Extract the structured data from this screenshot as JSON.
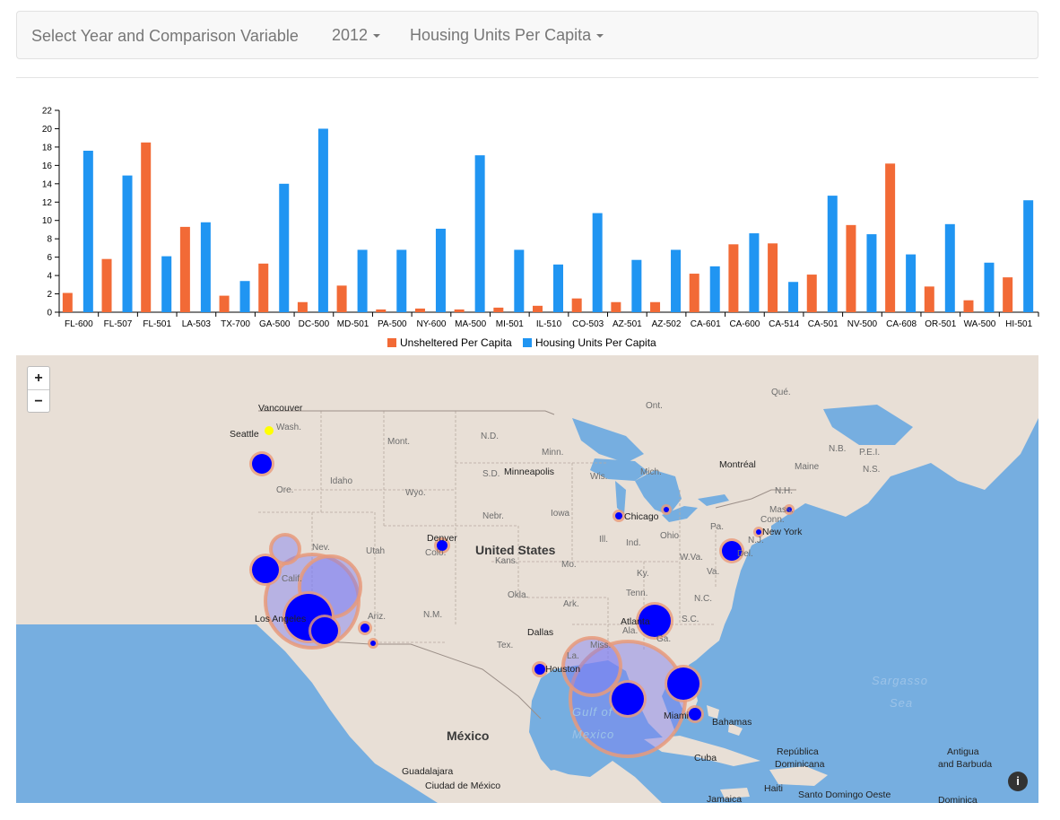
{
  "navbar": {
    "title": "Select Year and Comparison Variable",
    "year": "2012",
    "variable": "Housing Units Per Capita"
  },
  "colors": {
    "unsheltered": "#f26a36",
    "housing": "#2095f2",
    "bubble_fill": "#0000ff",
    "bubble_halo": "#e89a7a",
    "water": "#76aee0",
    "land": "#e8dfd6"
  },
  "chart_data": {
    "type": "bar",
    "categories": [
      "FL-600",
      "FL-507",
      "FL-501",
      "LA-503",
      "TX-700",
      "GA-500",
      "DC-500",
      "MD-501",
      "PA-500",
      "NY-600",
      "MA-500",
      "MI-501",
      "IL-510",
      "CO-503",
      "AZ-501",
      "AZ-502",
      "CA-601",
      "CA-600",
      "CA-514",
      "CA-501",
      "NV-500",
      "CA-608",
      "OR-501",
      "WA-500",
      "HI-501"
    ],
    "series": [
      {
        "name": "Unsheltered Per Capita",
        "values": [
          2.1,
          5.8,
          18.5,
          9.3,
          1.8,
          5.3,
          1.1,
          2.9,
          0.3,
          0.4,
          0.3,
          0.5,
          0.7,
          1.5,
          1.1,
          1.1,
          4.2,
          7.4,
          7.5,
          4.1,
          9.5,
          16.2,
          2.8,
          1.3,
          3.8
        ]
      },
      {
        "name": "Housing Units Per Capita",
        "values": [
          17.6,
          14.9,
          6.1,
          9.8,
          3.4,
          14.0,
          20.0,
          6.8,
          6.8,
          9.1,
          17.1,
          6.8,
          5.2,
          10.8,
          5.7,
          6.8,
          5.0,
          8.6,
          3.3,
          12.7,
          8.5,
          6.3,
          9.6,
          5.4,
          12.2
        ]
      }
    ],
    "yticks": [
      "0",
      "2",
      "4",
      "6",
      "8",
      "10",
      "12",
      "14",
      "16",
      "18",
      "20",
      "22"
    ],
    "ylim": [
      0,
      22
    ],
    "legend": "bottom-center"
  },
  "map": {
    "zoom_in": "+",
    "zoom_out": "−",
    "info": "i",
    "labels": {
      "vancouver": "Vancouver",
      "seattle": "Seattle",
      "wash": "Wash.",
      "mont": "Mont.",
      "nd": "N.D.",
      "minn": "Minn.",
      "ont": "Ont.",
      "que": "Qué.",
      "nb": "N.B.",
      "pei": "P.E.I.",
      "ns": "N.S.",
      "montreal": "Montréal",
      "maine": "Maine",
      "nh": "N.H.",
      "mass": "Mass.",
      "conn": "Conn.",
      "new_york": "New York",
      "nj": "N.J.",
      "del": "Del.",
      "pa": "Pa.",
      "ohio": "Ohio",
      "wva": "W.Va.",
      "va": "Va.",
      "ky": "Ky.",
      "tenn": "Tenn.",
      "nc": "N.C.",
      "sc": "S.C.",
      "ga": "Ga.",
      "ala": "Ala.",
      "atlanta": "Atlanta",
      "miss": "Miss.",
      "la": "La.",
      "ark": "Ark.",
      "mo": "Mo.",
      "ill": "Ill.",
      "ind": "Ind.",
      "mich": "Mich.",
      "wis": "Wis.",
      "iowa": "Iowa",
      "chicago": "Chicago",
      "minneapolis": "Minneapolis",
      "sd": "S.D.",
      "nebr": "Nebr.",
      "kans": "Kans.",
      "okla": "Okla.",
      "tex": "Tex.",
      "dallas": "Dallas",
      "houston": "Houston",
      "nm": "N.M.",
      "colo": "Colo.",
      "denver": "Denver",
      "wyo": "Wyo.",
      "idaho": "Idaho",
      "ore": "Ore.",
      "nev": "Nev.",
      "utah": "Utah",
      "ariz": "Ariz.",
      "calif": "Calif.",
      "los_angeles": "Los Angeles",
      "united_states": "United States",
      "mexico": "México",
      "guadalajara": "Guadalajara",
      "ciudad_mexico": "Ciudad de México",
      "gulf_of": "Gulf of",
      "mexico_sea": "Mexico",
      "miami": "Miami",
      "bahamas": "Bahamas",
      "cuba": "Cuba",
      "republica": "República",
      "dominicana": "Dominicana",
      "haiti": "Haiti",
      "santo_domingo": "Santo Domingo Oeste",
      "jamaica": "Jamaica",
      "antigua": "Antigua",
      "and_barbuda": "and Barbuda",
      "dominica": "Dominica",
      "sargasso": "Sargasso",
      "sea": "Sea"
    }
  }
}
